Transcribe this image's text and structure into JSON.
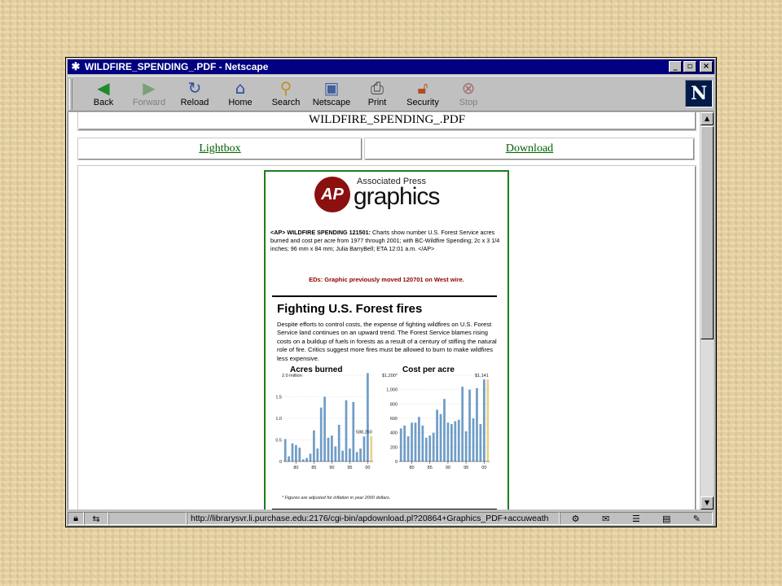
{
  "window": {
    "title": "WILDFIRE_SPENDING_.PDF - Netscape",
    "controls": {
      "minimize": "_",
      "maximize": "▫",
      "close": "×"
    }
  },
  "toolbar": {
    "buttons": [
      {
        "label": "Back",
        "icon": "back-arrow-icon",
        "enabled": true
      },
      {
        "label": "Forward",
        "icon": "forward-arrow-icon",
        "enabled": false
      },
      {
        "label": "Reload",
        "icon": "reload-icon",
        "enabled": true
      },
      {
        "label": "Home",
        "icon": "home-icon",
        "enabled": true
      },
      {
        "label": "Search",
        "icon": "search-icon",
        "enabled": true
      },
      {
        "label": "Netscape",
        "icon": "my-netscape-icon",
        "enabled": true
      },
      {
        "label": "Print",
        "icon": "print-icon",
        "enabled": true
      },
      {
        "label": "Security",
        "icon": "security-lock-icon",
        "enabled": true
      },
      {
        "label": "Stop",
        "icon": "stop-icon",
        "enabled": false
      }
    ],
    "logo": "N"
  },
  "page": {
    "title": "WILDFIRE_SPENDING_.PDF",
    "links": {
      "lightbox": "Lightbox ",
      "download": "Download"
    }
  },
  "graphic": {
    "logo": {
      "mark": "AP",
      "line1": "Associated Press",
      "line2": "graphics"
    },
    "slug_head": "<AP> WILDFIRE SPENDING 121501:",
    "slug_body": " Charts show number U.S. Forest Service acres burned and cost per acre from 1977 through 2001; with BC-Wildfire Spending; 2c x 3 1/4 inches; 96 mm x 84 mm; Julia BarryBell; ETA 12:01 a.m. </AP>",
    "eds_note": "EDs: Graphic previously moved 120701 on West wire.",
    "headline": "Fighting U.S. Forest fires",
    "deck": "Despite efforts to control costs, the expense of fighting wildfires on U.S. Forest Service land continues on an upward trend. The Forest Service blames rising costs on a buildup of fuels in forests as a result of a century of stifling the natural role of fire. Critics suggest more fires must be allowed to burn to make wildfires less expensive.",
    "footnote": "*  Figures are adjusted for inflation in year 2000 dollars."
  },
  "colors": {
    "bar": "#6f9dc7",
    "highlight": "#e8d28a",
    "frame_border": "#1d7d1d",
    "ap_red": "#8b1010",
    "eds_red": "#8b0000"
  },
  "chart_data": [
    {
      "type": "bar",
      "title": "Acres burned",
      "x": [
        1977,
        1978,
        1979,
        1980,
        1981,
        1982,
        1983,
        1984,
        1985,
        1986,
        1987,
        1988,
        1989,
        1990,
        1991,
        1992,
        1993,
        1994,
        1995,
        1996,
        1997,
        1998,
        1999,
        2000,
        2001
      ],
      "values": [
        0.52,
        0.12,
        0.42,
        0.38,
        0.32,
        0.05,
        0.08,
        0.18,
        0.72,
        0.3,
        1.25,
        1.5,
        0.55,
        0.6,
        0.35,
        0.85,
        0.25,
        1.42,
        0.3,
        1.38,
        0.22,
        0.3,
        0.58,
        2.05,
        0.59
      ],
      "highlight_label": "588,260",
      "ylim": [
        0,
        2.0
      ],
      "y_ticks": [
        "2.0 million",
        "1.5",
        "1.0",
        "0.5",
        "0"
      ],
      "x_ticks": [
        "80",
        "85",
        "90",
        "95",
        "00"
      ],
      "top_label": "2.0 million"
    },
    {
      "type": "bar",
      "title": "Cost per acre",
      "x": [
        1977,
        1978,
        1979,
        1980,
        1981,
        1982,
        1983,
        1984,
        1985,
        1986,
        1987,
        1988,
        1989,
        1990,
        1991,
        1992,
        1993,
        1994,
        1995,
        1996,
        1997,
        1998,
        1999,
        2000,
        2001
      ],
      "values": [
        460,
        500,
        350,
        540,
        540,
        620,
        500,
        330,
        360,
        400,
        720,
        660,
        870,
        540,
        520,
        560,
        580,
        1040,
        420,
        1000,
        600,
        1020,
        520,
        1141,
        1141
      ],
      "highlight_label": "$1,141",
      "ylim": [
        0,
        1200
      ],
      "y_ticks": [
        "$1,200*",
        "1,000",
        "800",
        "600",
        "400",
        "200",
        "0"
      ],
      "x_ticks": [
        "80",
        "85",
        "90",
        "95",
        "00"
      ]
    }
  ],
  "status": {
    "url": "http://librarysvr.li.purchase.edu:2176/cgi-bin/apdownload.pl?20864+Graphics_PDF+accuweath"
  }
}
